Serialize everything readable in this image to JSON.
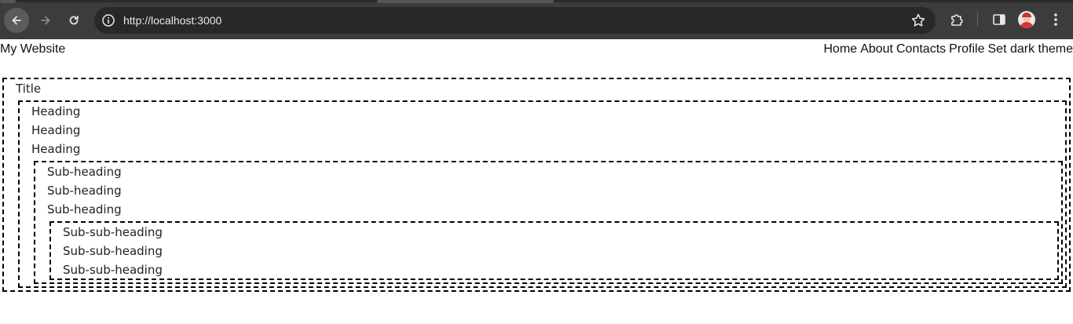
{
  "browser": {
    "url": "http://localhost:3000"
  },
  "header": {
    "site_name": "My Website",
    "nav": [
      "Home",
      "About",
      "Contacts",
      "Profile",
      "Set dark theme"
    ]
  },
  "content": {
    "title": "Title",
    "headings": [
      "Heading",
      "Heading",
      "Heading"
    ],
    "sub_headings": [
      "Sub-heading",
      "Sub-heading",
      "Sub-heading"
    ],
    "sub_sub_headings": [
      "Sub-sub-heading",
      "Sub-sub-heading",
      "Sub-sub-heading"
    ]
  }
}
